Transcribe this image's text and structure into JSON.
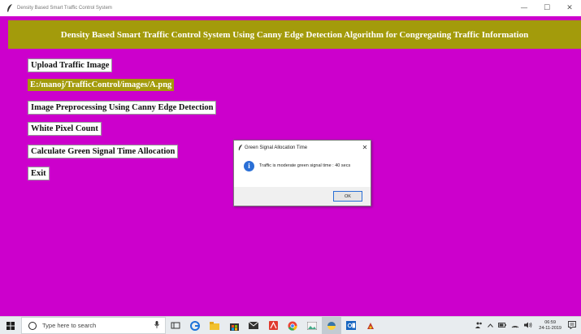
{
  "window": {
    "title": "Density Based Smart Traffic Control System",
    "minimize_glyph": "—",
    "maximize_glyph": "☐",
    "close_glyph": "✕"
  },
  "banner": {
    "title": "Density Based Smart Traffic Control System Using Canny Edge Detection Algorithm for Congregating Traffic Information"
  },
  "actions": {
    "upload": "Upload Traffic Image",
    "path": "E:/manoj/TrafficControl/images/A.png",
    "preprocess": "Image Preprocessing Using Canny Edge Detection",
    "pixel_count": "White Pixel Count",
    "green_time": "Calculate Green Signal Time Allocation",
    "exit": "Exit"
  },
  "dialog": {
    "title": "Green Signal Allocation Time",
    "message": "Traffic is moderate green signal time : 40 secs",
    "ok": "OK",
    "close_glyph": "✕",
    "info_glyph": "i"
  },
  "taskbar": {
    "search_placeholder": "Type here to search",
    "time": "06:59",
    "date": "24-11-2019",
    "icons": [
      "task-view-icon",
      "edge-icon",
      "file-explorer-icon",
      "store-icon",
      "mail-icon",
      "acrobat-icon",
      "chrome-icon",
      "image-viewer-icon",
      "python-icon",
      "outlook-icon",
      "paint-icon"
    ]
  },
  "colors": {
    "background": "#cc00cc",
    "banner": "#a39b0b",
    "path_label": "#a39b0b",
    "info_icon": "#2a6fd6"
  }
}
